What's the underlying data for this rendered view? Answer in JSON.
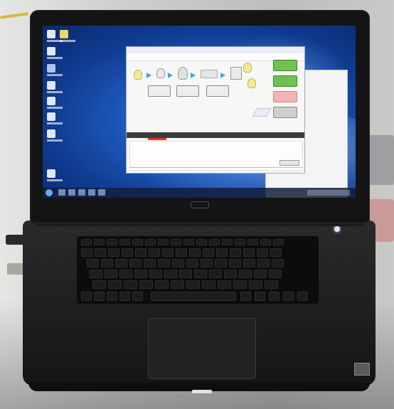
{
  "scene": {
    "subject": "laptop",
    "screen_colors": {
      "desktop_blue": "#1f5bbf",
      "window_bg": "#f7f7f5",
      "green_buttons": "#6ec24f",
      "red_marker": "#e4342f"
    }
  },
  "icons": {
    "desktop": [
      "desktop-icon",
      "desktop-icon",
      "desktop-icon",
      "desktop-icon",
      "desktop-icon",
      "desktop-icon",
      "desktop-icon"
    ],
    "taskbar": [
      "start-icon",
      "taskbar-icon",
      "taskbar-icon",
      "taskbar-icon",
      "taskbar-icon",
      "taskbar-icon"
    ]
  }
}
